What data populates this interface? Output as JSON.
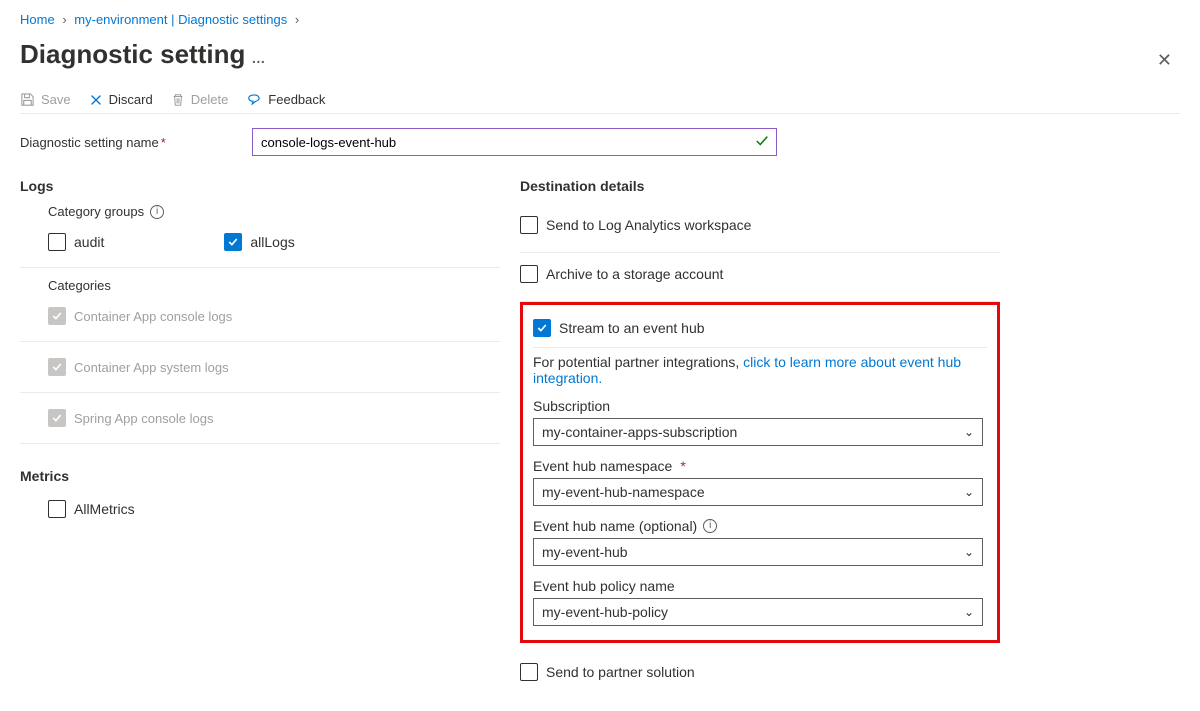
{
  "breadcrumb": {
    "home": "Home",
    "envLabel": "my-environment | Diagnostic settings"
  },
  "title": "Diagnostic setting",
  "toolbar": {
    "save": "Save",
    "discard": "Discard",
    "delete": "Delete",
    "feedback": "Feedback"
  },
  "nameField": {
    "label": "Diagnostic setting name",
    "value": "console-logs-event-hub"
  },
  "logs": {
    "heading": "Logs",
    "categoryGroupsLabel": "Category groups",
    "audit": "audit",
    "allLogs": "allLogs",
    "categoriesLabel": "Categories",
    "categories": [
      "Container App console logs",
      "Container App system logs",
      "Spring App console logs"
    ]
  },
  "metrics": {
    "heading": "Metrics",
    "allMetrics": "AllMetrics"
  },
  "dest": {
    "heading": "Destination details",
    "logAnalytics": "Send to Log Analytics workspace",
    "archive": "Archive to a storage account",
    "eventHub": {
      "label": "Stream to an event hub",
      "help1": "For potential partner integrations, ",
      "helpLink": "click to learn more about event hub integration.",
      "subscriptionLabel": "Subscription",
      "subscriptionValue": "my-container-apps-subscription",
      "namespaceLabel": "Event hub namespace",
      "namespaceValue": "my-event-hub-namespace",
      "nameLabel": "Event hub name (optional)",
      "nameValue": "my-event-hub",
      "policyLabel": "Event hub policy name",
      "policyValue": "my-event-hub-policy"
    },
    "partner": "Send to partner solution"
  }
}
